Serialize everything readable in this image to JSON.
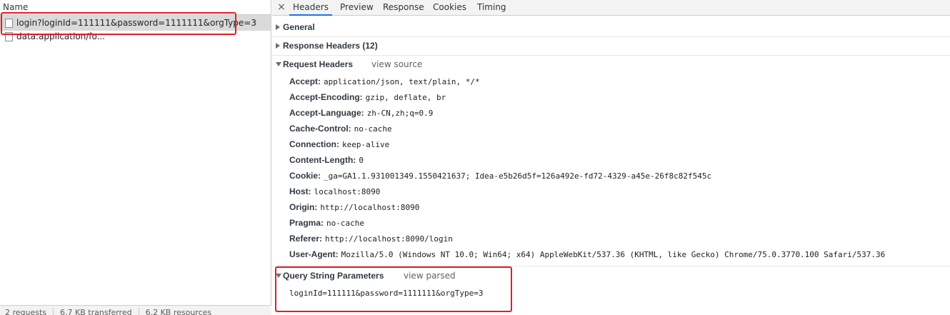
{
  "left": {
    "column_header": "Name",
    "requests": [
      {
        "name": "login?loginId=111111&password=1111111&orgType=3"
      },
      {
        "name": "data:application/fo..."
      }
    ],
    "footer": {
      "requests": "2 requests",
      "transferred": "6.7 KB transferred",
      "resources": "6.2 KB resources"
    }
  },
  "tabs": [
    {
      "label": "Headers",
      "active": true
    },
    {
      "label": "Preview"
    },
    {
      "label": "Response"
    },
    {
      "label": "Cookies"
    },
    {
      "label": "Timing"
    }
  ],
  "close_symbol": "×",
  "sections": {
    "general": {
      "title": "General"
    },
    "response_headers": {
      "title": "Response Headers (12)"
    },
    "request_headers": {
      "title": "Request Headers",
      "link": "view source",
      "rows": [
        {
          "name": "Accept:",
          "value": "application/json, text/plain, */*"
        },
        {
          "name": "Accept-Encoding:",
          "value": "gzip, deflate, br"
        },
        {
          "name": "Accept-Language:",
          "value": "zh-CN,zh;q=0.9"
        },
        {
          "name": "Cache-Control:",
          "value": "no-cache"
        },
        {
          "name": "Connection:",
          "value": "keep-alive"
        },
        {
          "name": "Content-Length:",
          "value": "0"
        },
        {
          "name": "Cookie:",
          "value": "_ga=GA1.1.931001349.1550421637; Idea-e5b26d5f=126a492e-fd72-4329-a45e-26f8c82f545c"
        },
        {
          "name": "Host:",
          "value": "localhost:8090"
        },
        {
          "name": "Origin:",
          "value": "http://localhost:8090"
        },
        {
          "name": "Pragma:",
          "value": "no-cache"
        },
        {
          "name": "Referer:",
          "value": "http://localhost:8090/login"
        },
        {
          "name": "User-Agent:",
          "value": "Mozilla/5.0 (Windows NT 10.0; Win64; x64) AppleWebKit/537.36 (KHTML, like Gecko) Chrome/75.0.3770.100 Safari/537.36"
        }
      ]
    },
    "query_string": {
      "title": "Query String Parameters",
      "link": "view parsed",
      "value": "loginId=111111&password=1111111&orgType=3"
    }
  },
  "colors": {
    "highlight_box": "#e51c23",
    "active_tab_underline": "#1a73e8",
    "selected_row": "#dadada"
  }
}
